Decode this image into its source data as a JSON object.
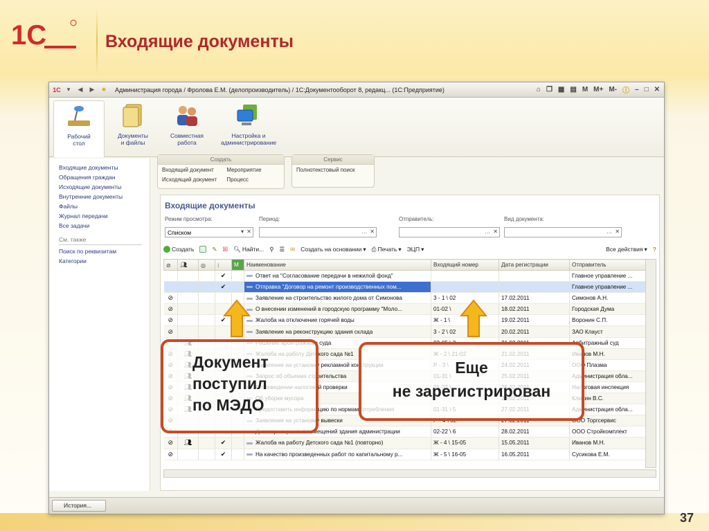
{
  "slide": {
    "title": "Входящие документы",
    "number": "37"
  },
  "window": {
    "title": "Администрация города / Фролова Е.М. (делопроизводитель) / 1С:Документооборот 8, редакц... (1С:Предприятие)",
    "controls": [
      "M",
      "M+",
      "M-"
    ]
  },
  "sections": [
    {
      "label_line1": "Рабочий",
      "label_line2": "стол"
    },
    {
      "label_line1": "Документы",
      "label_line2": "и файлы"
    },
    {
      "label_line1": "Совместная",
      "label_line2": "работа"
    },
    {
      "label_line1": "Настройка и",
      "label_line2": "администрирование"
    }
  ],
  "nav": {
    "items": [
      "Входящие документы",
      "Обращения граждан",
      "Исходящие документы",
      "Внутренние документы",
      "Файлы",
      "Журнал передачи",
      "Все задачи"
    ],
    "see_also": "См. также",
    "see_items": [
      "Поиск по реквизитам",
      "Категории"
    ]
  },
  "groups": {
    "create": {
      "title": "Создать",
      "items": [
        "Входящий документ",
        "Исходящий документ",
        "Мероприятие",
        "Процесс"
      ]
    },
    "service": {
      "title": "Сервис",
      "items": [
        "Полнотекстовый поиск"
      ]
    }
  },
  "list": {
    "title": "Входящие документы",
    "filters": {
      "mode_label": "Режим просмотра:",
      "mode_value": "Списком",
      "period_label": "Период:",
      "sender_label": "Отправитель:",
      "doctype_label": "Вид документа:"
    },
    "toolbar": {
      "create": "Создать",
      "find": "Найти...",
      "create_based": "Создать на основании",
      "print": "Печать",
      "ecp": "ЭЦП",
      "all_actions": "Все действия"
    },
    "columns": [
      "Наименование",
      "Входящий номер",
      "Дата регистрации",
      "Отправитель"
    ],
    "rows": [
      {
        "name": "Ответ на \"Согласование передачи в нежилой фонд\"",
        "number": "",
        "date": "",
        "sender": "Главное управление ...",
        "clip": false,
        "group": false,
        "check": true
      },
      {
        "name": "Отправка \"Договор на ремонт производственных пом...",
        "number": "",
        "date": "",
        "sender": "Главное управление ...",
        "clip": false,
        "group": false,
        "check": true
      },
      {
        "name": "Заявление на строительство жилого дома от Симонова",
        "number": "3 - 1 \\ 02",
        "date": "17.02.2011",
        "sender": "Симонов А.Н.",
        "clip": true,
        "group": false,
        "check": false
      },
      {
        "name": "О внесении изменений в городскую программу \"Моло...",
        "number": "01-02 \\",
        "date": "18.02.2011",
        "sender": "Городская Дума",
        "clip": true,
        "group": false,
        "check": false
      },
      {
        "name": "Жалоба на отключение горячей воды",
        "number": "Ж - 1 \\",
        "date": "19.02.2011",
        "sender": "Воронин С.П.",
        "clip": true,
        "group": false,
        "check": true
      },
      {
        "name": "Заявление на реконструкцию здания склада",
        "number": "3 - 2 \\ 02",
        "date": "20.02.2011",
        "sender": "ЗАО Клауст",
        "clip": true,
        "group": false,
        "check": false
      },
      {
        "name": "Решение арбитражного суда",
        "number": "03-05 \\ 2",
        "date": "21.02.2011",
        "sender": "Арбитражный суд",
        "clip": false,
        "group": true,
        "check": false
      },
      {
        "name": "Жалоба на работу Детского сада №1",
        "number": "Ж - 2 \\ 21-02",
        "date": "21.02.2011",
        "sender": "Иванов М.Н.",
        "clip": true,
        "group": true,
        "check": false
      },
      {
        "name": "Заявление на установку рекламной конструкции",
        "number": "Р - 3 \\",
        "date": "24.02.2011",
        "sender": "ООО Плазма",
        "clip": true,
        "group": true,
        "check": false
      },
      {
        "name": "Запрос об объемах строительства",
        "number": "01-31 \\",
        "date": "25.02.2011",
        "sender": "Администрация обла...",
        "clip": true,
        "group": true,
        "check": false
      },
      {
        "name": "О проведении налоговой проверки",
        "number": "01-32 \\",
        "date": "26.02.2011",
        "sender": "Налоговая инспекция",
        "clip": true,
        "group": true,
        "check": false
      },
      {
        "name": "Об уборке мусора",
        "number": "",
        "date": "26.02.2011",
        "sender": "Клинин В.С.",
        "clip": true,
        "group": true,
        "check": false
      },
      {
        "name": "Предоставить информацию по нормам потребления",
        "number": "01-31 \\ 5",
        "date": "27.02.2011",
        "sender": "Администрация обла...",
        "clip": true,
        "group": true,
        "check": false
      },
      {
        "name": "Заявление на установку вывески",
        "number": "Р - 4 \\ 02",
        "date": "27.02.2011",
        "sender": "ООО Торгсервис",
        "clip": true,
        "group": false,
        "check": false
      },
      {
        "name": "Договор на ремонт помещений здания администрации",
        "number": "02-22 \\ 6",
        "date": "28.02.2011",
        "sender": "ООО Стройкомплект",
        "clip": true,
        "group": false,
        "check": false
      },
      {
        "name": "Жалоба на работу Детского сада №1 (повторно)",
        "number": "Ж - 4 \\ 15-05",
        "date": "15.05.2011",
        "sender": "Иванов М.Н.",
        "clip": true,
        "group": true,
        "check": true
      },
      {
        "name": "На качество произведенных работ по капитальному р...",
        "number": "Ж - 5 \\ 16-05",
        "date": "16.05.2011",
        "sender": "Сусикова Е.М.",
        "clip": true,
        "group": false,
        "check": true
      }
    ]
  },
  "history_button": "История...",
  "callouts": {
    "left": [
      "Документ",
      "поступил",
      "по МЭДО"
    ],
    "right": [
      "Еще",
      "не зарегистрирован"
    ]
  },
  "colors": {
    "title_red": "#b3262a",
    "callout_border": "#c94a24",
    "arrow_fill": "#f5b81c",
    "selection_blue": "#3d6fd0"
  }
}
